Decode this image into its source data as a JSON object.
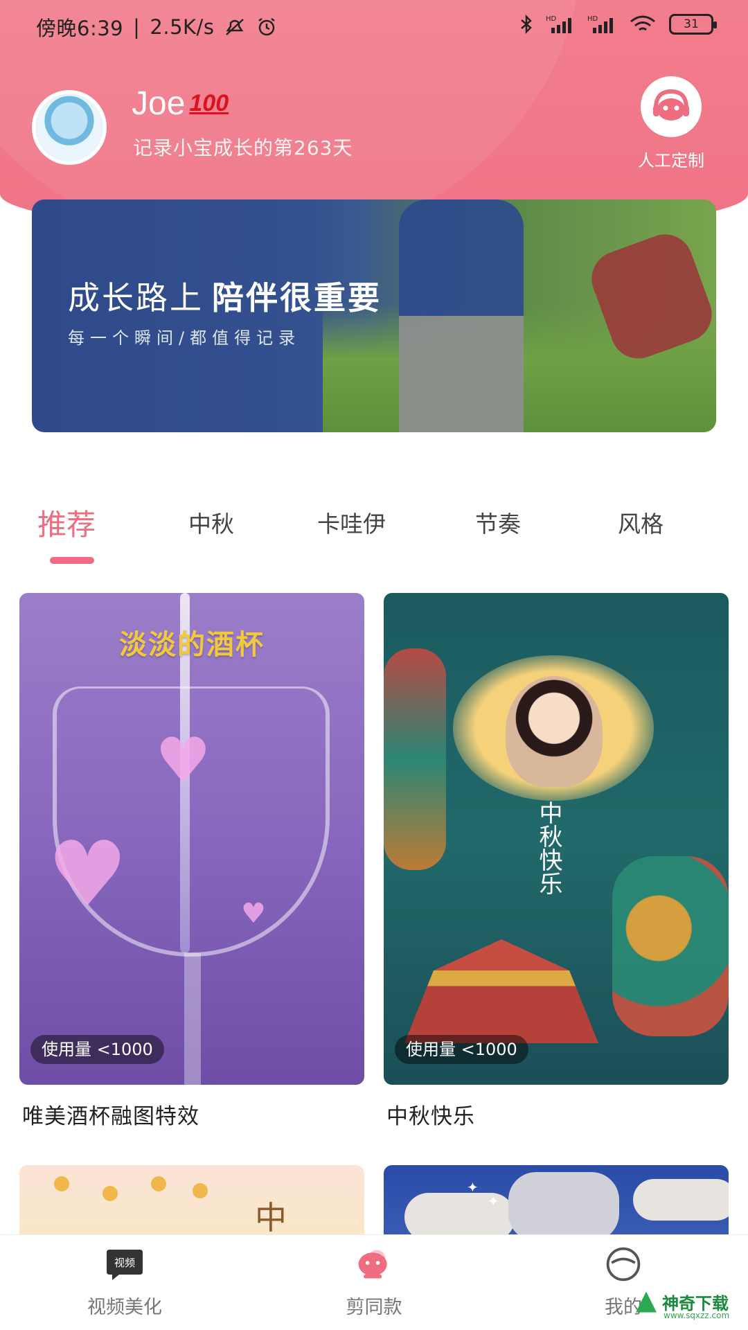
{
  "status_bar": {
    "time": "傍晚6:39",
    "network_speed": "2.5K/s",
    "battery": "31",
    "icons": [
      "mute-icon",
      "alarm-icon",
      "bluetooth-icon",
      "signal-hd-icon",
      "signal-hd-icon",
      "wifi-icon",
      "battery-icon"
    ]
  },
  "profile": {
    "username": "Joe",
    "badge": "100",
    "subtitle": "记录小宝成长的第263天"
  },
  "custom_service": {
    "label": "人工定制",
    "icon": "customer-service-icon"
  },
  "banner": {
    "title_regular": "成长路上",
    "title_bold": "陪伴很重要",
    "subtitle": "每一个瞬间/都值得记录"
  },
  "tabs": [
    {
      "label": "推荐",
      "active": true
    },
    {
      "label": "中秋",
      "active": false
    },
    {
      "label": "卡哇伊",
      "active": false
    },
    {
      "label": "节奏",
      "active": false
    },
    {
      "label": "风格",
      "active": false
    }
  ],
  "cards": [
    {
      "image_text": "淡淡的酒杯",
      "usage": "使用量 <1000",
      "title": "唯美酒杯融图特效"
    },
    {
      "image_text": "中秋快乐",
      "usage": "使用量 <1000",
      "title": "中秋快乐"
    }
  ],
  "peek_cards": [
    {
      "image_text": "中"
    },
    {
      "image_text": ""
    }
  ],
  "bottom_nav": [
    {
      "label": "视频美化",
      "icon": "video-beautify-icon",
      "icon_text": "视频"
    },
    {
      "label": "剪同款",
      "icon": "template-icon"
    },
    {
      "label": "我的",
      "icon": "profile-icon"
    }
  ],
  "watermark": {
    "text": "神奇下载",
    "url": "www.sqxzz.com"
  },
  "colors": {
    "header": "#f27e8e",
    "accent": "#ee6d80"
  }
}
